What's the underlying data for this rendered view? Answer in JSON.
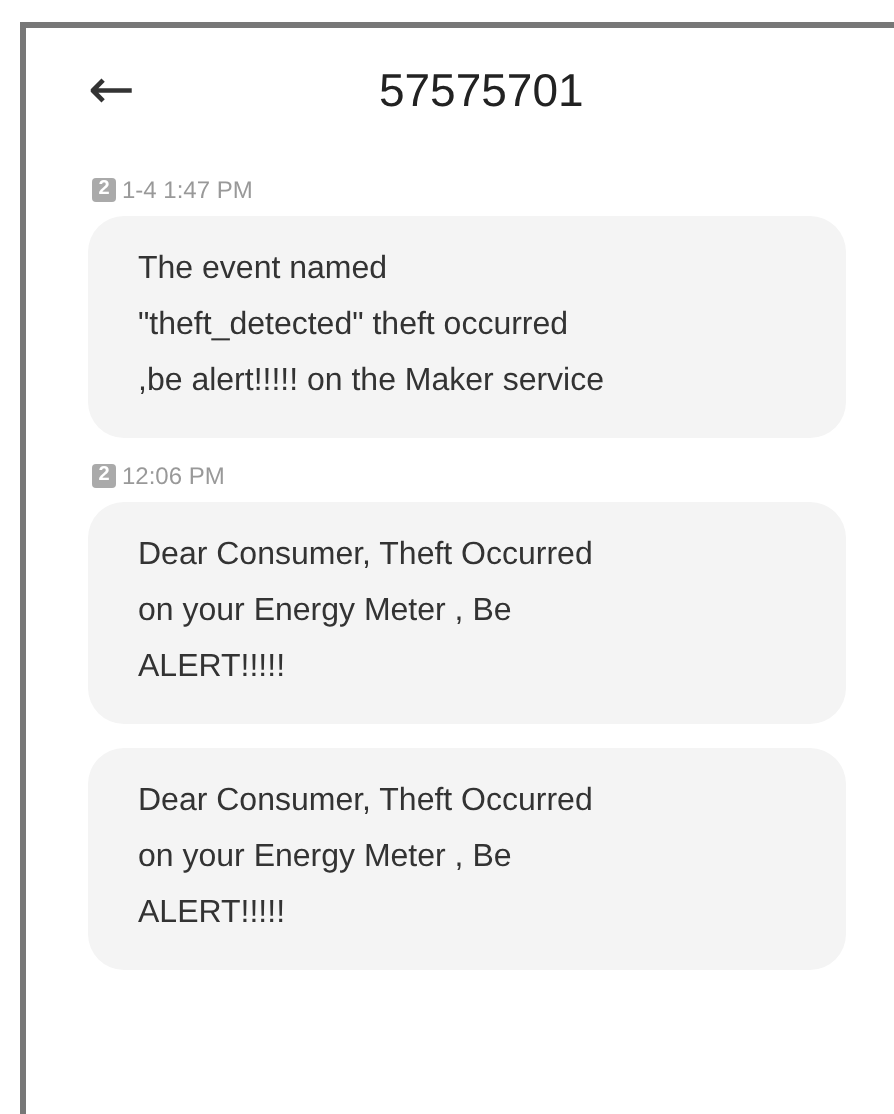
{
  "header": {
    "back": "←",
    "title": "57575701"
  },
  "groups": [
    {
      "sim": "2",
      "time": "1-4 1:47 PM",
      "messages": [
        "The event named \"theft_detected\" theft occurred ,be alert!!!!! on the Maker service"
      ]
    },
    {
      "sim": "2",
      "time": "12:06 PM",
      "messages": [
        "Dear Consumer, Theft Occurred on your Energy Meter , Be ALERT!!!!!",
        "Dear Consumer, Theft Occurred on your Energy Meter , Be ALERT!!!!!"
      ]
    }
  ]
}
